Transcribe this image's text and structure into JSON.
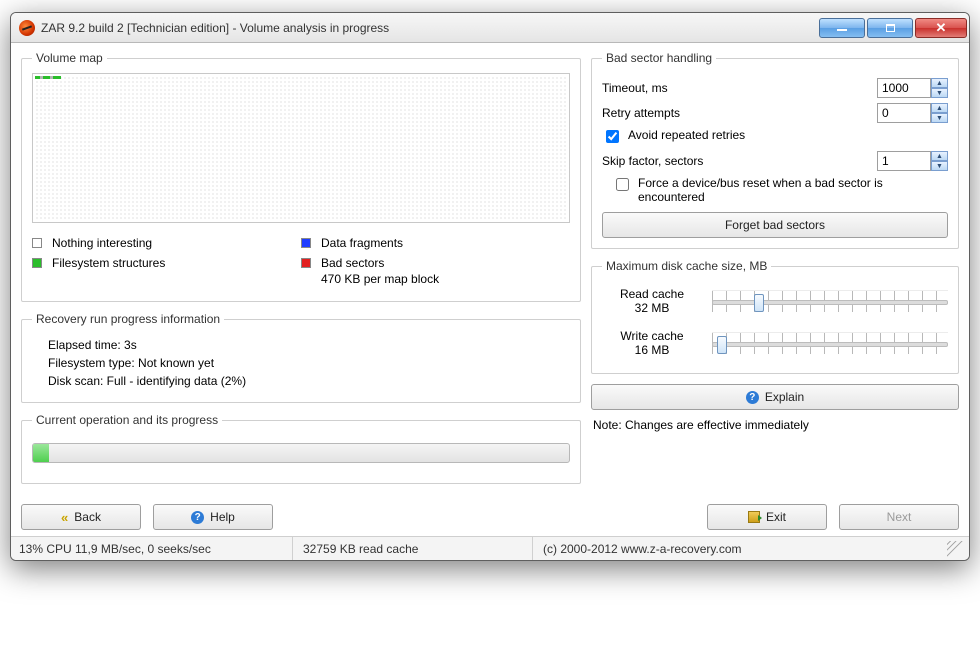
{
  "window": {
    "title": "ZAR 9.2 build 2 [Technician edition] - Volume analysis in progress"
  },
  "left": {
    "volume_map": {
      "legend_title": "Volume map"
    },
    "legend": {
      "nothing": "Nothing interesting",
      "fs": "Filesystem structures",
      "frag": "Data fragments",
      "bad": "Bad sectors",
      "block": "470 KB per map block"
    },
    "progress_info": {
      "legend_title": "Recovery run progress information",
      "elapsed": "Elapsed time: 3s",
      "fstype": "Filesystem type: Not known yet",
      "scan": "Disk scan: Full - identifying data (2%)"
    },
    "current_op": {
      "legend_title": "Current operation and its progress",
      "percent": 3
    }
  },
  "right": {
    "bad": {
      "legend_title": "Bad sector handling",
      "timeout_label": "Timeout, ms",
      "timeout_value": "1000",
      "retry_label": "Retry attempts",
      "retry_value": "0",
      "avoid_label": "Avoid repeated retries",
      "avoid_checked": true,
      "skip_label": "Skip factor, sectors",
      "skip_value": "1",
      "force_label": "Force a device/bus reset when a bad sector is encountered",
      "force_checked": false,
      "forget_btn": "Forget bad sectors"
    },
    "cache": {
      "legend_title": "Maximum disk cache size, MB",
      "read_label": "Read cache",
      "read_value": "32 MB",
      "read_pos_pct": 18,
      "write_label": "Write cache",
      "write_value": "16 MB",
      "write_pos_pct": 2
    },
    "explain_btn": "Explain",
    "note": "Note: Changes are effective immediately"
  },
  "buttons": {
    "back": "Back",
    "help": "Help",
    "exit": "Exit",
    "next": "Next"
  },
  "status": {
    "cpu": "13% CPU 11,9 MB/sec, 0 seeks/sec",
    "cache": "32759 KB read cache",
    "copyright": "(c) 2000-2012 www.z-a-recovery.com"
  }
}
